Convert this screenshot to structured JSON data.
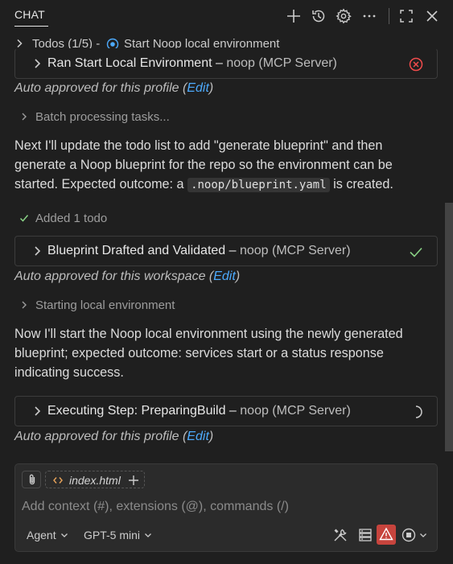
{
  "header": {
    "tab_label": "CHAT",
    "icons": [
      "new-chat-icon",
      "history-icon",
      "gear-icon",
      "more-icon",
      "maximize-icon",
      "close-icon"
    ]
  },
  "todos": {
    "label": "Todos (1/5) -",
    "current": "Start Noop local environment"
  },
  "items": {
    "card1": {
      "title": "Ran Start Local Environment",
      "dash": " – ",
      "server": "noop (MCP Server)",
      "status": "error"
    },
    "approved1": {
      "prefix": "Auto approved for this profile (",
      "link": "Edit",
      "suffix": ")"
    },
    "progress1": "Batch processing tasks...",
    "para1": {
      "before": "Next I'll update the todo list to add \"generate blueprint\" and then generate a Noop blueprint for the repo so the environment can be started. Expected outcome: a ",
      "code": ".noop/blueprint.yaml",
      "after": " is created."
    },
    "progress2": "Added 1 todo",
    "card2": {
      "title": "Blueprint Drafted and Validated",
      "dash": " – ",
      "server": "noop (MCP Server)",
      "status": "success"
    },
    "approved2": {
      "prefix": "Auto approved for this workspace (",
      "link": "Edit",
      "suffix": ")"
    },
    "progress3": "Starting local environment",
    "para2": "Now I'll start the Noop local environment using the newly generated blueprint; expected outcome: services start or a status response indicating success.",
    "card3": {
      "title": "Executing Step: PreparingBuild",
      "dash": " – ",
      "server": "noop (MCP Server)",
      "status": "running"
    },
    "approved3": {
      "prefix": "Auto approved for this profile (",
      "link": "Edit",
      "suffix": ")"
    }
  },
  "input": {
    "attachment": "index.html",
    "placeholder": "Add context (#), extensions (@), commands (/)",
    "mode": "Agent",
    "model": "GPT-5 mini",
    "toolbar_icons": [
      "tools-icon",
      "server-icon",
      "warning-icon",
      "stop-icon"
    ]
  },
  "colors": {
    "background": "#1f1f1f",
    "link": "#4daafc",
    "error": "#f14c4c",
    "success": "#89d185",
    "warning_bg": "#c7443d"
  }
}
